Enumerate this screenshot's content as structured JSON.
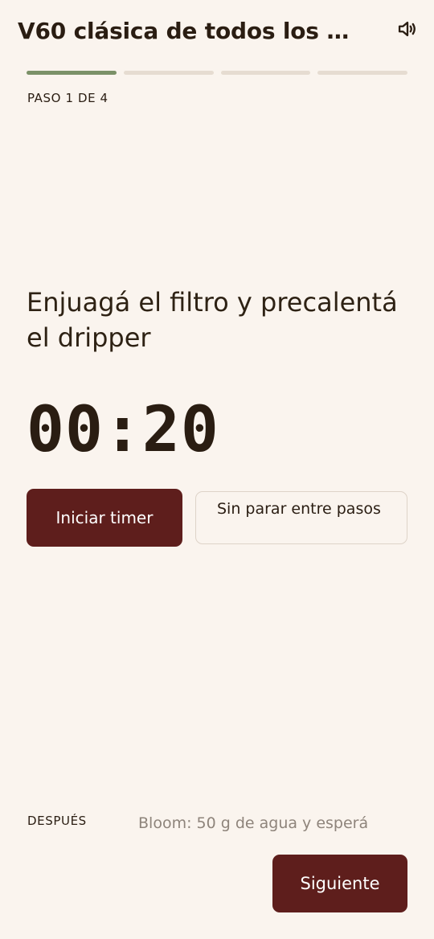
{
  "header": {
    "title": "V60 clásica de todos los …",
    "sound_icon": "speaker-icon"
  },
  "progress": {
    "total_steps": 4,
    "current_step": 1,
    "step_label": "PASO 1 DE 4",
    "colors": {
      "active": "#7B9168",
      "inactive": "#E6DCD1"
    }
  },
  "step": {
    "instruction": "Enjuagá el filtro y precalentá el dripper",
    "timer": "00:20"
  },
  "actions": {
    "start_timer_label": "Iniciar timer",
    "continuous_label": "Sin parar entre pasos"
  },
  "next": {
    "label": "DESPUÉS",
    "preview": "Bloom: 50 g de agua y esperá",
    "button_label": "Siguiente"
  },
  "colors": {
    "background": "#FAF4EE",
    "primary": "#5E1E1C",
    "text": "#2A1D12",
    "muted": "#8E847B"
  }
}
